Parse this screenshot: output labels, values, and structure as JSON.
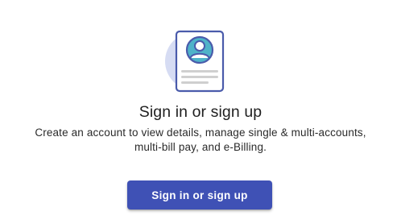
{
  "empty_state": {
    "icon": "profile-document-icon",
    "title": "Sign in or sign up",
    "description_line1": "Create an account to view details, manage single & multi-accounts,",
    "description_line2": "multi-bill pay, and e-Billing.",
    "cta_label": "Sign in or sign up"
  },
  "colors": {
    "accent": "#3f51b5",
    "illustration_circle": "#d6dcf3",
    "avatar_fill": "#4fb3c9",
    "outline": "#4a5bab"
  }
}
